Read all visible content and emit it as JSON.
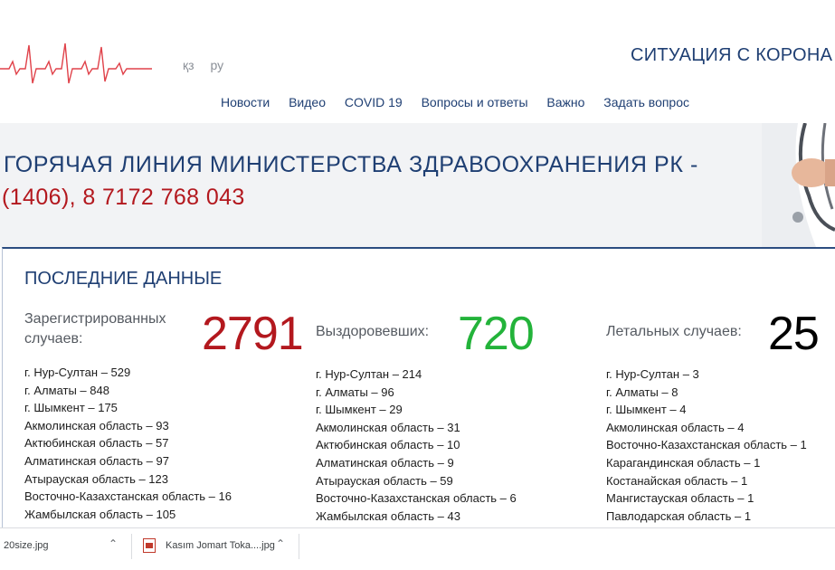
{
  "header": {
    "languages": [
      "қз",
      "ру"
    ],
    "site_title": "СИТУАЦИЯ С КОРОНА",
    "nav": [
      "Новости",
      "Видео",
      "COVID 19",
      "Вопросы и ответы",
      "Важно",
      "Задать вопрос"
    ]
  },
  "hero": {
    "hotline_title": "ГОРЯЧАЯ ЛИНИЯ МИНИСТЕРСТВА ЗДРАВООХРАНЕНИЯ РК -",
    "hotline_phone": "(1406), 8 7172 768 043"
  },
  "panel": {
    "title": "ПОСЛЕДНИЕ ДАННЫЕ",
    "registered": {
      "label": "Зарегистрированных случаев:",
      "value": "2791",
      "color": "#b3181e",
      "regions": [
        "г. Нур-Султан – 529",
        "г. Алматы – 848",
        "г. Шымкент – 175",
        "Акмолинская область – 93",
        "Актюбинская область – 57",
        "Алматинская область – 97",
        "Атырауская область – 123",
        "Восточно-Казахстанская область – 16",
        "Жамбылская область – 105"
      ]
    },
    "recovered": {
      "label": "Выздоровевших:",
      "value": "720",
      "color": "#23b33a",
      "regions": [
        "г. Нур-Султан – 214",
        "г. Алматы – 96",
        "г. Шымкент – 29",
        "Акмолинская область – 31",
        "Актюбинская область – 10",
        "Алматинская область – 9",
        "Атырауская область – 59",
        "Восточно-Казахстанская область – 6",
        "Жамбылская область – 43"
      ]
    },
    "deaths": {
      "label": "Летальных случаев:",
      "value": "25",
      "color": "#000000",
      "regions": [
        "г. Нур-Султан – 3",
        "г. Алматы – 8",
        "г. Шымкент – 4",
        "Акмолинская область – 4",
        "Восточно-Казахстанская область – 1",
        "Карагандинская область – 1",
        "Костанайская область – 1",
        "Мангистауская область – 1",
        "Павлодарская область – 1"
      ]
    }
  },
  "downloads": [
    {
      "name": "20size.jpg",
      "icon": "chevron-up-icon"
    },
    {
      "name": "Kasım Jomart Toka....jpg",
      "icon": "image-file-icon"
    }
  ],
  "colors": {
    "accent": "#1f3f73",
    "hotline_phone": "#b3181e",
    "ecg_line": "#e0424a"
  }
}
